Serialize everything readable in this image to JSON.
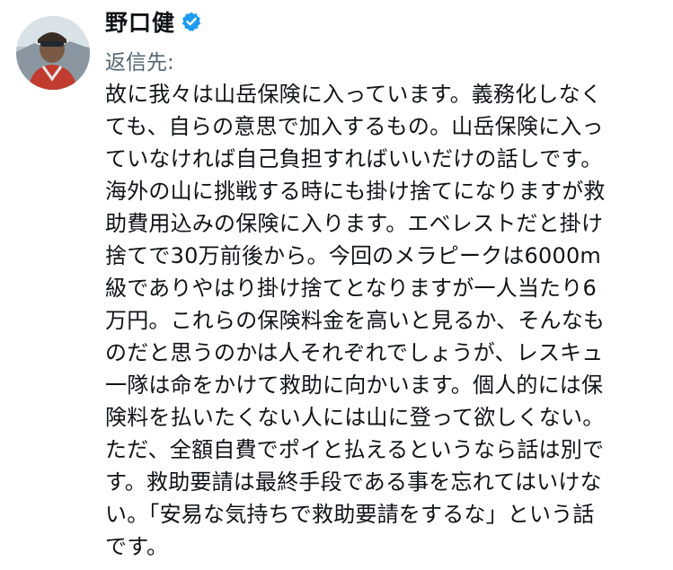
{
  "tweet": {
    "author_name": "野口健",
    "verified_icon": "verified-badge-icon",
    "reply_label": "返信先:",
    "body_lines": [
      "故に我々は山岳保険に入っています。義務化しなく",
      "ても、自らの意思で加入するもの。山岳保険に入っ",
      "ていなければ自己負担すればいいだけの話しです。",
      "海外の山に挑戦する時にも掛け捨てになりますが救",
      "助費用込みの保険に入ります。エベレストだと掛け",
      "捨てで30万前後から。今回のメラピークは6000m",
      "級でありやはり掛け捨てとなりますが一人当たり6",
      "万円。これらの保険料金を高いと見るか、そんなも",
      "のだと思うのかは人それぞれでしょうが、レスキュ",
      "一隊は命をかけて救助に向かいます。個人的には保",
      "険料を払いたくない人には山に登って欲しくない。",
      "ただ、全額自費でポイと払えるというなら話は別で",
      "す。救助要請は最終手段である事を忘れてはいけな",
      "い。「安易な気持ちで救助要請をするな」という話",
      "です。"
    ]
  },
  "colors": {
    "text": "#0f1419",
    "secondary_text": "#536471",
    "verified": "#1d9bf0"
  }
}
